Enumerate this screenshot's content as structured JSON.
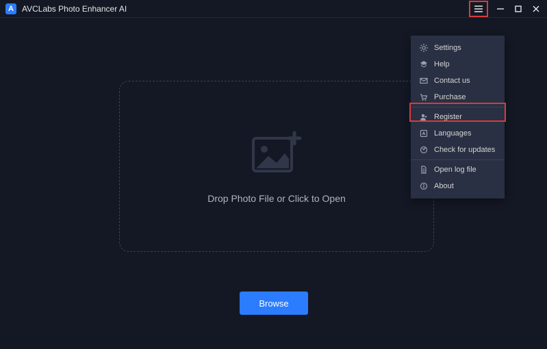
{
  "titlebar": {
    "app_title": "AVCLabs Photo Enhancer AI",
    "logo_letter": "A"
  },
  "dropzone": {
    "text": "Drop Photo File or Click to Open"
  },
  "browse": {
    "label": "Browse"
  },
  "menu": {
    "items": [
      {
        "label": "Settings"
      },
      {
        "label": "Help"
      },
      {
        "label": "Contact us"
      },
      {
        "label": "Purchase"
      },
      {
        "label": "Register"
      },
      {
        "label": "Languages"
      },
      {
        "label": "Check for updates"
      },
      {
        "label": "Open log file"
      },
      {
        "label": "About"
      }
    ]
  }
}
